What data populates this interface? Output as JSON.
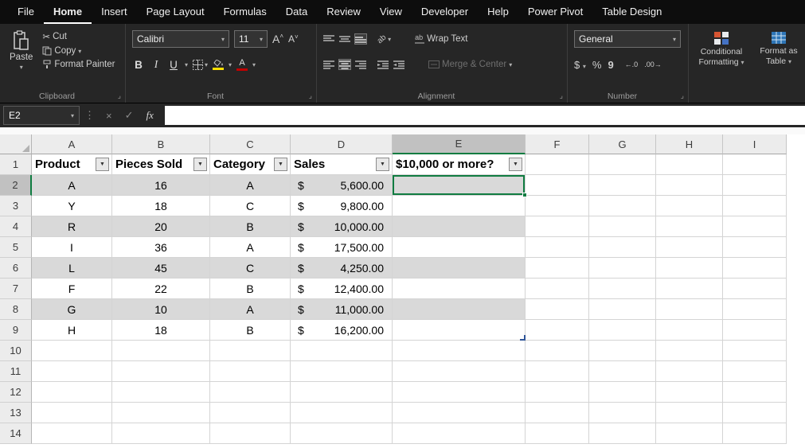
{
  "colors": {
    "accent": "#107C41",
    "band": "#D9D9D9",
    "fill_yellow": "#FFE000",
    "font_red": "#C00000",
    "table_blue": "#2F5597"
  },
  "menu": {
    "tabs": [
      {
        "label": "File"
      },
      {
        "label": "Home",
        "active": true
      },
      {
        "label": "Insert"
      },
      {
        "label": "Page Layout"
      },
      {
        "label": "Formulas"
      },
      {
        "label": "Data"
      },
      {
        "label": "Review"
      },
      {
        "label": "View"
      },
      {
        "label": "Developer"
      },
      {
        "label": "Help"
      },
      {
        "label": "Power Pivot"
      },
      {
        "label": "Table Design"
      }
    ]
  },
  "ribbon": {
    "clipboard": {
      "group_label": "Clipboard",
      "paste_label": "Paste",
      "cut_label": "Cut",
      "copy_label": "Copy",
      "format_painter_label": "Format Painter"
    },
    "font": {
      "group_label": "Font",
      "font_name": "Calibri",
      "font_size": "11",
      "bold": "B",
      "italic": "I",
      "underline": "U",
      "grow": "A",
      "shrink": "A"
    },
    "alignment": {
      "group_label": "Alignment",
      "wrap_text_label": "Wrap Text",
      "merge_center_label": "Merge & Center"
    },
    "number": {
      "group_label": "Number",
      "format": "General",
      "currency": "$",
      "percent": "%",
      "comma": "9",
      "increase_decimal": "←.0",
      "decrease_decimal": ".00→"
    },
    "styles": {
      "conditional_formatting_label": "Conditional Formatting",
      "format_as_table_label": "Format as Table"
    }
  },
  "formula_bar": {
    "name_box": "E2",
    "cancel": "×",
    "enter": "✓",
    "fx_label": "fx",
    "formula": ""
  },
  "grid": {
    "columns": [
      "A",
      "B",
      "C",
      "D",
      "E",
      "F",
      "G",
      "H",
      "I"
    ],
    "row_count": 14,
    "selected_column": "E",
    "selected_row_header": 2,
    "active_cell": "E2",
    "table": {
      "currency": "$",
      "headers": [
        "Product",
        "Pieces Sold",
        "Category",
        "Sales",
        "$10,000 or more?"
      ],
      "rows": [
        {
          "product": "A",
          "pieces_sold": "16",
          "category": "A",
          "sales": "5,600.00"
        },
        {
          "product": "Y",
          "pieces_sold": "18",
          "category": "C",
          "sales": "9,800.00"
        },
        {
          "product": "R",
          "pieces_sold": "20",
          "category": "B",
          "sales": "10,000.00"
        },
        {
          "product": "I",
          "pieces_sold": "36",
          "category": "A",
          "sales": "17,500.00"
        },
        {
          "product": "L",
          "pieces_sold": "45",
          "category": "C",
          "sales": "4,250.00"
        },
        {
          "product": "F",
          "pieces_sold": "22",
          "category": "B",
          "sales": "12,400.00"
        },
        {
          "product": "G",
          "pieces_sold": "10",
          "category": "A",
          "sales": "11,000.00"
        },
        {
          "product": "H",
          "pieces_sold": "18",
          "category": "B",
          "sales": "16,200.00"
        }
      ]
    }
  }
}
